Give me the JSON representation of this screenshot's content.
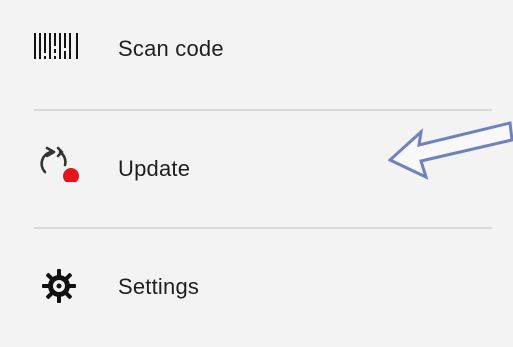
{
  "menu": {
    "items": [
      {
        "label": "Scan code",
        "icon": "barcode-icon"
      },
      {
        "label": "Update",
        "icon": "refresh-update-icon",
        "badge_color": "#e8141c"
      },
      {
        "label": "Settings",
        "icon": "gear-icon"
      }
    ]
  },
  "colors": {
    "background": "#f4f3f3",
    "divider": "#d9d9d9",
    "text": "#1f1f1f",
    "update_badge": "#e8141c",
    "callout_arrow_fill": "#f8f8fb",
    "callout_arrow_stroke": "#6f82bd"
  },
  "annotation": {
    "icon": "left-arrow-callout-icon",
    "points_to": "Update"
  }
}
